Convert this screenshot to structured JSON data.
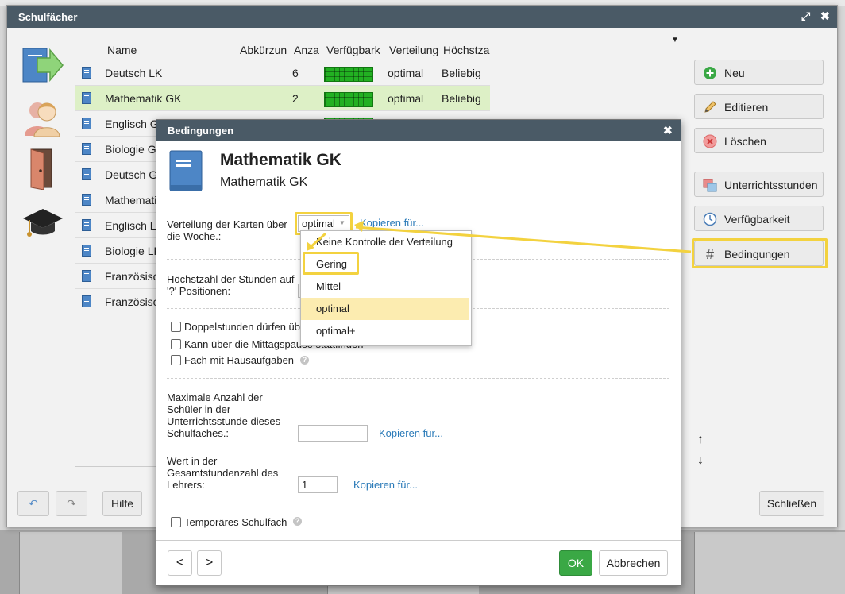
{
  "window": {
    "title": "Schulfächer",
    "expand_icon": "↗↙",
    "close_icon": "✖"
  },
  "table": {
    "columns": [
      "Name",
      "Abkürzun",
      "Anza",
      "Verfügbark",
      "Verteilung",
      "Höchstza"
    ],
    "rows": [
      {
        "name": "Deutsch LK",
        "count": "6",
        "distribution": "optimal",
        "max": "Beliebig"
      },
      {
        "name": "Mathematik GK",
        "count": "2",
        "distribution": "optimal",
        "max": "Beliebig"
      },
      {
        "name": "Englisch GK",
        "count": "",
        "distribution": "",
        "max": ""
      },
      {
        "name": "Biologie Gk",
        "count": "",
        "distribution": "",
        "max": ""
      },
      {
        "name": "Deutsch GK",
        "count": "",
        "distribution": "",
        "max": ""
      },
      {
        "name": "Mathematik",
        "count": "",
        "distribution": "",
        "max": ""
      },
      {
        "name": "Englisch LK",
        "count": "",
        "distribution": "",
        "max": ""
      },
      {
        "name": "Biologie LK",
        "count": "",
        "distribution": "",
        "max": ""
      },
      {
        "name": "Französisch",
        "count": "",
        "distribution": "",
        "max": ""
      },
      {
        "name": "Französisch",
        "count": "",
        "distribution": "",
        "max": ""
      }
    ]
  },
  "actions": {
    "new": "Neu",
    "edit": "Editieren",
    "delete": "Löschen",
    "lessons": "Unterrichtsstunden",
    "availability": "Verfügbarkeit",
    "conditions": "Bedingungen"
  },
  "bottom": {
    "help": "Hilfe",
    "close": "Schließen"
  },
  "dialog": {
    "title": "Bedingungen",
    "subject_name": "Mathematik GK",
    "subject_subtitle": "Mathematik GK",
    "distribution_label_1": "Verteilung der Karten über",
    "distribution_label_2": "die Woche.:",
    "distribution_value": "optimal",
    "copy_for": "Kopieren für...",
    "max_hours_label_1": "Höchstzahl der Stunden auf",
    "max_hours_label_2": "'?' Positionen:",
    "double_lessons": "Doppelstunden dürfen üb",
    "lunch_break": "Kann über die Mittagspause stattfinden",
    "homework": "Fach mit Hausaufgaben",
    "max_students_label": [
      "Maximale Anzahl der",
      "Schüler in der",
      "Unterrichtsstunde dieses",
      "Schulfaches.:"
    ],
    "max_students_value": "",
    "teacher_value_label": [
      "Wert in der",
      "Gesamtstundenzahl des",
      "Lehrers:"
    ],
    "teacher_value": "1",
    "temporary": "Temporäres Schulfach",
    "prev": "<",
    "next": ">",
    "ok": "OK",
    "cancel": "Abbrechen",
    "options": [
      "Keine Kontrolle der Verteilung",
      "Gering",
      "Mittel",
      "optimal",
      "optimal+"
    ],
    "selected_option": "optimal",
    "highlighted_option": "Gering"
  },
  "colors": {
    "titlebar": "#4a5a66",
    "selected_row": "#ddf0c6",
    "highlight": "#f3d23f",
    "ok_button": "#3aa845",
    "link": "#2a7ab8"
  }
}
